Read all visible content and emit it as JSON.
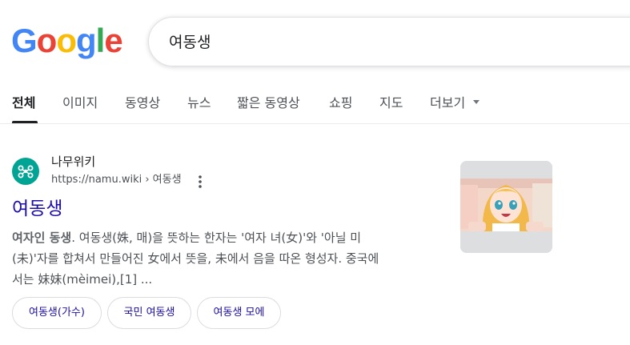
{
  "logo": {
    "letters": [
      "G",
      "o",
      "o",
      "g",
      "l",
      "e"
    ],
    "colors": [
      "#4285F4",
      "#EA4335",
      "#FBBC05",
      "#4285F4",
      "#34A853",
      "#EA4335"
    ]
  },
  "search": {
    "query": "여동생"
  },
  "tabs": [
    {
      "label": "전체",
      "active": true
    },
    {
      "label": "이미지",
      "active": false
    },
    {
      "label": "동영상",
      "active": false
    },
    {
      "label": "뉴스",
      "active": false
    },
    {
      "label": "짧은 동영상",
      "active": false
    },
    {
      "label": "쇼핑",
      "active": false
    },
    {
      "label": "지도",
      "active": false
    },
    {
      "label": "더보기",
      "active": false
    }
  ],
  "result": {
    "site_name": "나무위키",
    "url": "https://namu.wiki › 여동생",
    "favicon_icon": "namuwiki-logo-icon",
    "title": "여동생",
    "snippet_bold": "여자인 동생",
    "snippet_rest_line1": ". 여동생(姝, 매)을 뜻하는 한자는 '여자 녀(女)'와 '아닐 미",
    "snippet_line2": "(未)'자를 합쳐서 만들어진 女에서 뜻을, 未에서 음을 따온 형성자. 중국에",
    "snippet_line3": "서는 妹妹(mèimei),[1] ...",
    "thumbnail_icon": "anime-girl-thumbnail",
    "chips": [
      "여동생(가수)",
      "국민 여동생",
      "여동생 모에"
    ]
  },
  "colors": {
    "link": "#1a0dab",
    "favicon_bg": "#00a495"
  }
}
